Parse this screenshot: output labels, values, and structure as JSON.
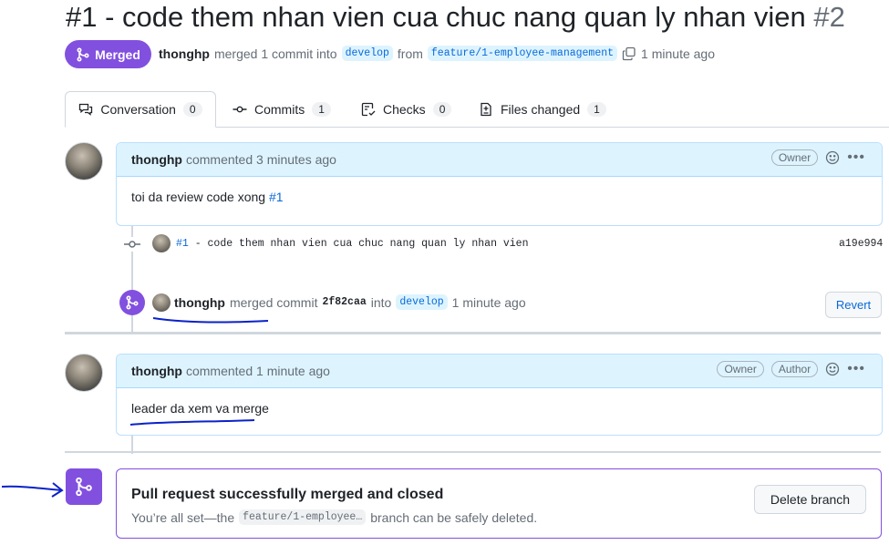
{
  "pr": {
    "title": "#1 - code them nhan vien cua chuc nang quan ly nhan vien",
    "number": "#2",
    "state_label": "Merged",
    "author": "thonghp",
    "merged_text": "merged 1 commit into",
    "base_branch": "develop",
    "from_text": "from",
    "head_branch": "feature/1-employee-management",
    "time": "1 minute ago"
  },
  "tabs": [
    {
      "label": "Conversation",
      "count": "0"
    },
    {
      "label": "Commits",
      "count": "1"
    },
    {
      "label": "Checks",
      "count": "0"
    },
    {
      "label": "Files changed",
      "count": "1"
    }
  ],
  "comment1": {
    "author": "thonghp",
    "action": "commented 3 minutes ago",
    "badge": "Owner",
    "body_text": "toi da review code xong ",
    "body_link": "#1"
  },
  "commit": {
    "link": "#1",
    "message": " - code them nhan vien cua chuc nang quan ly nhan vien",
    "sha": "a19e994"
  },
  "merge_event": {
    "author": "thonghp",
    "text1": "merged commit",
    "sha": "2f82caa",
    "text2": "into",
    "branch": "develop",
    "time": "1 minute ago",
    "revert_label": "Revert"
  },
  "comment2": {
    "author": "thonghp",
    "action": "commented 1 minute ago",
    "badge_owner": "Owner",
    "badge_author": "Author",
    "body_text": "leader da xem va merge"
  },
  "merged_box": {
    "title": "Pull request successfully merged and closed",
    "text_before": "You’re all set—the",
    "branch": "feature/1-employee…",
    "text_after": "branch can be safely deleted.",
    "delete_label": "Delete branch"
  },
  "colors": {
    "merged_purple": "#8250df",
    "link_blue": "#0969da",
    "annotation_blue": "#0b22c8"
  }
}
